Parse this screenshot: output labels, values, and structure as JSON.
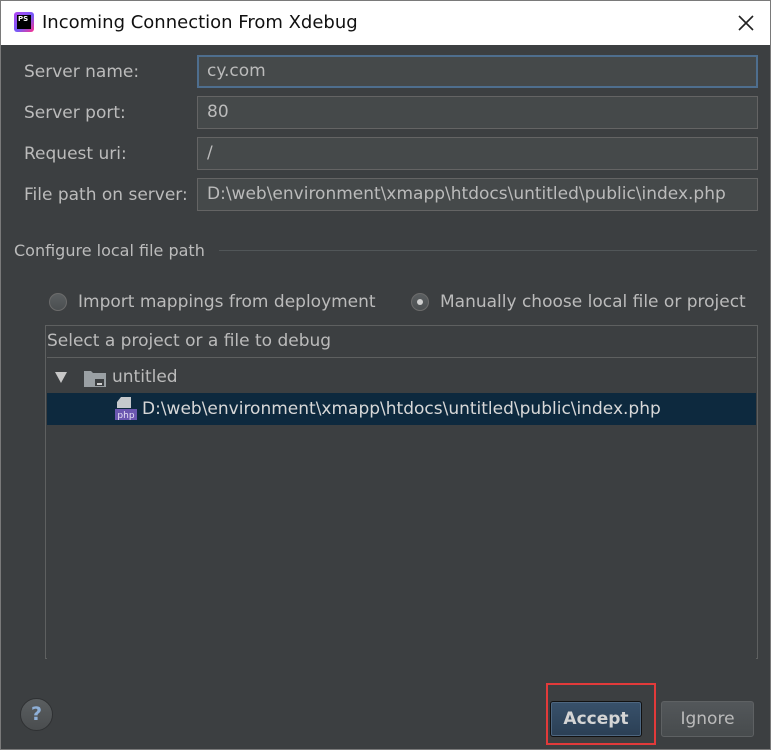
{
  "window": {
    "title": "Incoming Connection From Xdebug",
    "app_icon_text": "PS"
  },
  "form": {
    "server_name_label": "Server name:",
    "server_name_value": "cy.com",
    "server_port_label": "Server port:",
    "server_port_value": "80",
    "request_uri_label": "Request uri:",
    "request_uri_value": "/",
    "file_path_label": "File path on server:",
    "file_path_value": "D:\\web\\environment\\xmapp\\htdocs\\untitled\\public\\index.php"
  },
  "local_path": {
    "section_title": "Configure local file path",
    "option_import": "Import mappings from deployment",
    "option_manual": "Manually choose local file or project",
    "selected_option": "manual"
  },
  "tree": {
    "header": "Select a project or a file to debug",
    "root_label": "untitled",
    "file_label": "D:\\web\\environment\\xmapp\\htdocs\\untitled\\public\\index.php",
    "file_icon_text": "php"
  },
  "buttons": {
    "help": "?",
    "accept": "Accept",
    "ignore": "Ignore"
  },
  "colors": {
    "dialog_bg": "#3c3f41",
    "selection_bg": "#0d293e",
    "highlight_outline": "#e23a3a"
  }
}
